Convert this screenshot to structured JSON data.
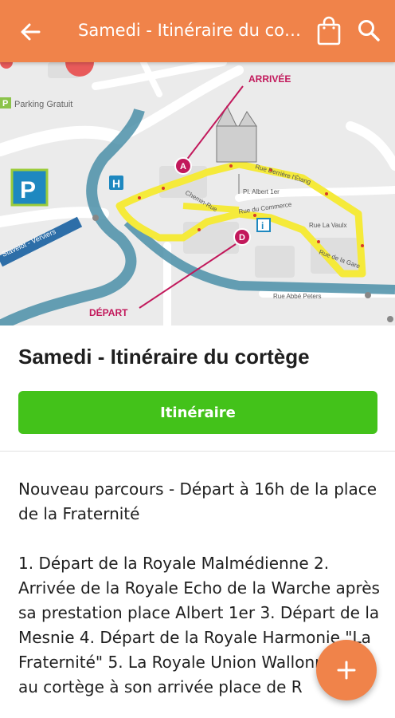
{
  "appbar": {
    "title": "Samedi - Itinéraire du cortège"
  },
  "map": {
    "labels": {
      "arrivee": "ARRIVÉE",
      "depart": "DÉPART",
      "parking": "Parking Gratuit",
      "stavelot": "Stavelot - Verviers",
      "place_albert": "Pl. Albert 1er",
      "rue_abbe": "Rue Abbé Peters",
      "rue_vaulx": "Rue La Vaulx",
      "rue_gare": "Rue de la Gare",
      "rue_commerce": "Rue du Commerce",
      "chemin_rue": "Chemin-Rue",
      "rue_derriere": "Rue Derrière l'Étang",
      "marker_a": "A",
      "marker_d": "D",
      "parking_p": "P",
      "hospital_h": "H",
      "info_i": "i"
    }
  },
  "event": {
    "title": "Samedi - Itinéraire du cortège",
    "button_label": "Itinéraire",
    "description": "Nouveau parcours - Départ à 16h de la place de la Fraternité\n\n1. Départ de la Royale Malmédienne 2. Arrivée de la Royale Echo de la Warche après sa prestation place Albert 1er  3. Départ de la Mesnie  4. Départ de la Royale Harmonie \"La Fraternité\"  5. La Royale Union Wallonne joint au cortège à son arrivée place de R"
  },
  "colors": {
    "accent": "#f0834a",
    "button": "#43c21a",
    "route": "#f5ea3a",
    "marker": "#c2185b"
  }
}
